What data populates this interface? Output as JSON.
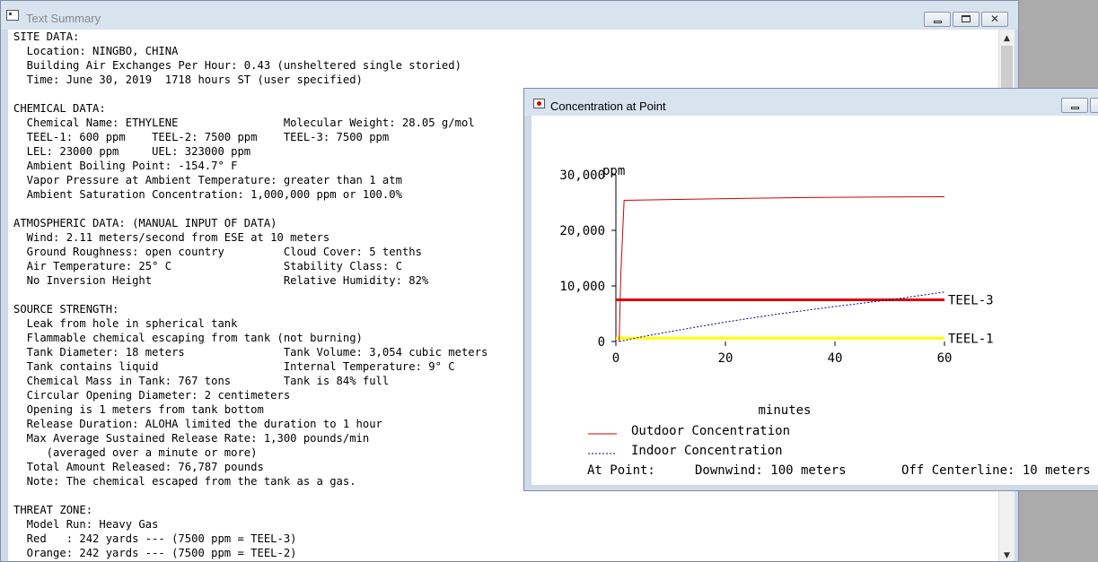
{
  "text_summary_window": {
    "title": "Text Summary",
    "close_label": "✕",
    "report_lines": [
      "SITE DATA:",
      "  Location: NINGBO, CHINA",
      "  Building Air Exchanges Per Hour: 0.43 (unsheltered single storied)",
      "  Time: June 30, 2019  1718 hours ST (user specified)",
      "",
      "CHEMICAL DATA:",
      "  Chemical Name: ETHYLENE                Molecular Weight: 28.05 g/mol",
      "  TEEL-1: 600 ppm    TEEL-2: 7500 ppm    TEEL-3: 7500 ppm",
      "  LEL: 23000 ppm     UEL: 323000 ppm",
      "  Ambient Boiling Point: -154.7° F",
      "  Vapor Pressure at Ambient Temperature: greater than 1 atm",
      "  Ambient Saturation Concentration: 1,000,000 ppm or 100.0%",
      "",
      "ATMOSPHERIC DATA: (MANUAL INPUT OF DATA)",
      "  Wind: 2.11 meters/second from ESE at 10 meters",
      "  Ground Roughness: open country         Cloud Cover: 5 tenths",
      "  Air Temperature: 25° C                 Stability Class: C",
      "  No Inversion Height                    Relative Humidity: 82%",
      "",
      "SOURCE STRENGTH:",
      "  Leak from hole in spherical tank",
      "  Flammable chemical escaping from tank (not burning)",
      "  Tank Diameter: 18 meters               Tank Volume: 3,054 cubic meters",
      "  Tank contains liquid                   Internal Temperature: 9° C",
      "  Chemical Mass in Tank: 767 tons        Tank is 84% full",
      "  Circular Opening Diameter: 2 centimeters",
      "  Opening is 1 meters from tank bottom",
      "  Release Duration: ALOHA limited the duration to 1 hour",
      "  Max Average Sustained Release Rate: 1,300 pounds/min",
      "     (averaged over a minute or more)",
      "  Total Amount Released: 76,787 pounds",
      "  Note: The chemical escaped from the tank as a gas.",
      "",
      "THREAT ZONE:",
      "  Model Run: Heavy Gas",
      "  Red   : 242 yards --- (7500 ppm = TEEL-3)",
      "  Orange: 242 yards --- (7500 ppm = TEEL-2)"
    ]
  },
  "concentration_window": {
    "title": "Concentration at Point",
    "legend": {
      "outdoor": "Outdoor Concentration",
      "indoor": "Indoor Concentration"
    },
    "at_point": {
      "label": "At Point:",
      "downwind": "Downwind: 100 meters",
      "off_centerline": "Off Centerline: 10 meters"
    }
  },
  "chart_data": {
    "type": "line",
    "ylabel": "ppm",
    "xlabel": "minutes",
    "xlim": [
      0,
      60
    ],
    "ylim": [
      0,
      30000
    ],
    "x_ticks": [
      0,
      20,
      40,
      60
    ],
    "x_tick_labels": [
      "0",
      "20",
      "40",
      "60"
    ],
    "y_ticks": [
      0,
      10000,
      20000,
      30000
    ],
    "y_tick_labels": [
      "0",
      "10,000",
      "20,000",
      "30,000"
    ],
    "series": [
      {
        "name": "Outdoor Concentration",
        "color": "#d40000",
        "style": "solid",
        "x": [
          0.6,
          0.9,
          1.5,
          10,
          20,
          30,
          40,
          50,
          60
        ],
        "y": [
          0,
          12000,
          25400,
          25550,
          25700,
          25850,
          25950,
          26000,
          26050
        ]
      },
      {
        "name": "Indoor Concentration",
        "color": "#000080",
        "style": "dotted",
        "x": [
          0.6,
          5,
          10,
          20,
          30,
          40,
          50,
          60
        ],
        "y": [
          0,
          900,
          1800,
          3500,
          5000,
          6300,
          7500,
          8900
        ]
      }
    ],
    "thresholds": [
      {
        "name": "TEEL-3",
        "value": 7500,
        "color": "#e00000"
      },
      {
        "name": "TEEL-1",
        "value": 600,
        "color": "#ffff00"
      }
    ]
  }
}
